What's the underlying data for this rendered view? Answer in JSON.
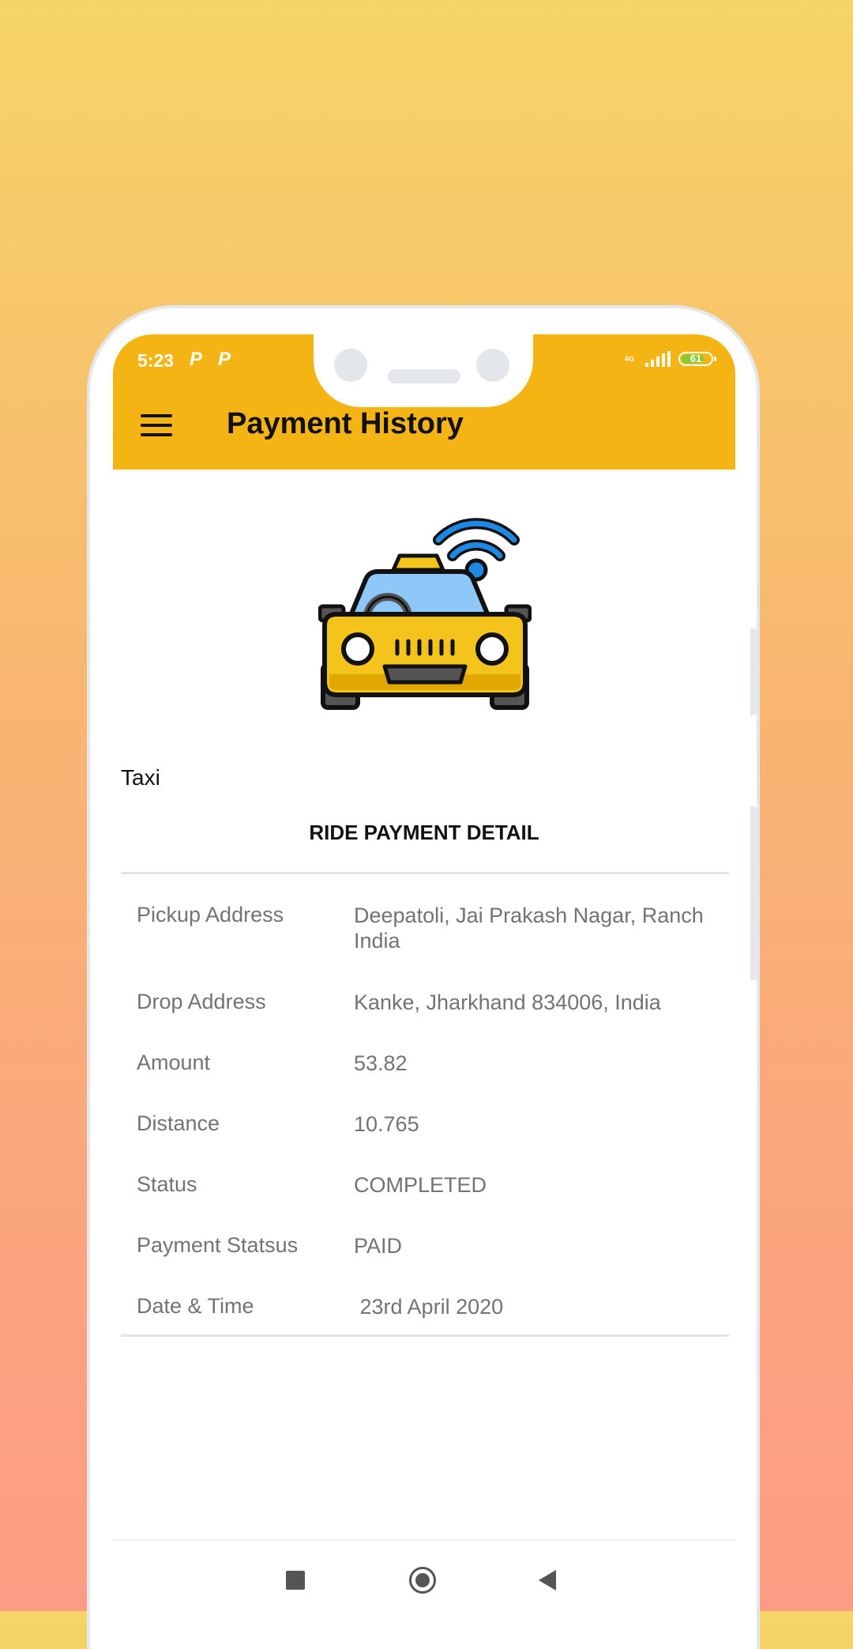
{
  "status_bar": {
    "time": "5:23",
    "notification_icons": [
      "P",
      "P"
    ],
    "network": "4G",
    "battery": "61",
    "battery_color": "#7BD03A"
  },
  "app_bar": {
    "title": "Payment History",
    "background": "#F4B514",
    "menu_icon": "hamburger-menu-icon"
  },
  "vehicle": {
    "image": "taxi-wifi-icon",
    "label": "Taxi"
  },
  "section_title": "RIDE PAYMENT DETAIL",
  "details": [
    {
      "label": "Pickup Address",
      "value": "Deepatoli, Jai Prakash Nagar, Ranch India"
    },
    {
      "label": "Drop Address",
      "value": "Kanke, Jharkhand 834006, India"
    },
    {
      "label": "Amount",
      "value": "53.82"
    },
    {
      "label": "Distance",
      "value": "10.765"
    },
    {
      "label": "Status",
      "value": "COMPLETED"
    },
    {
      "label": "Payment Statsus",
      "value": "PAID"
    },
    {
      "label": "Date & Time",
      "value": " 23rd April 2020"
    }
  ],
  "nav_bar": {
    "buttons": [
      "recents-square-icon",
      "home-circle-icon",
      "back-triangle-icon"
    ]
  }
}
